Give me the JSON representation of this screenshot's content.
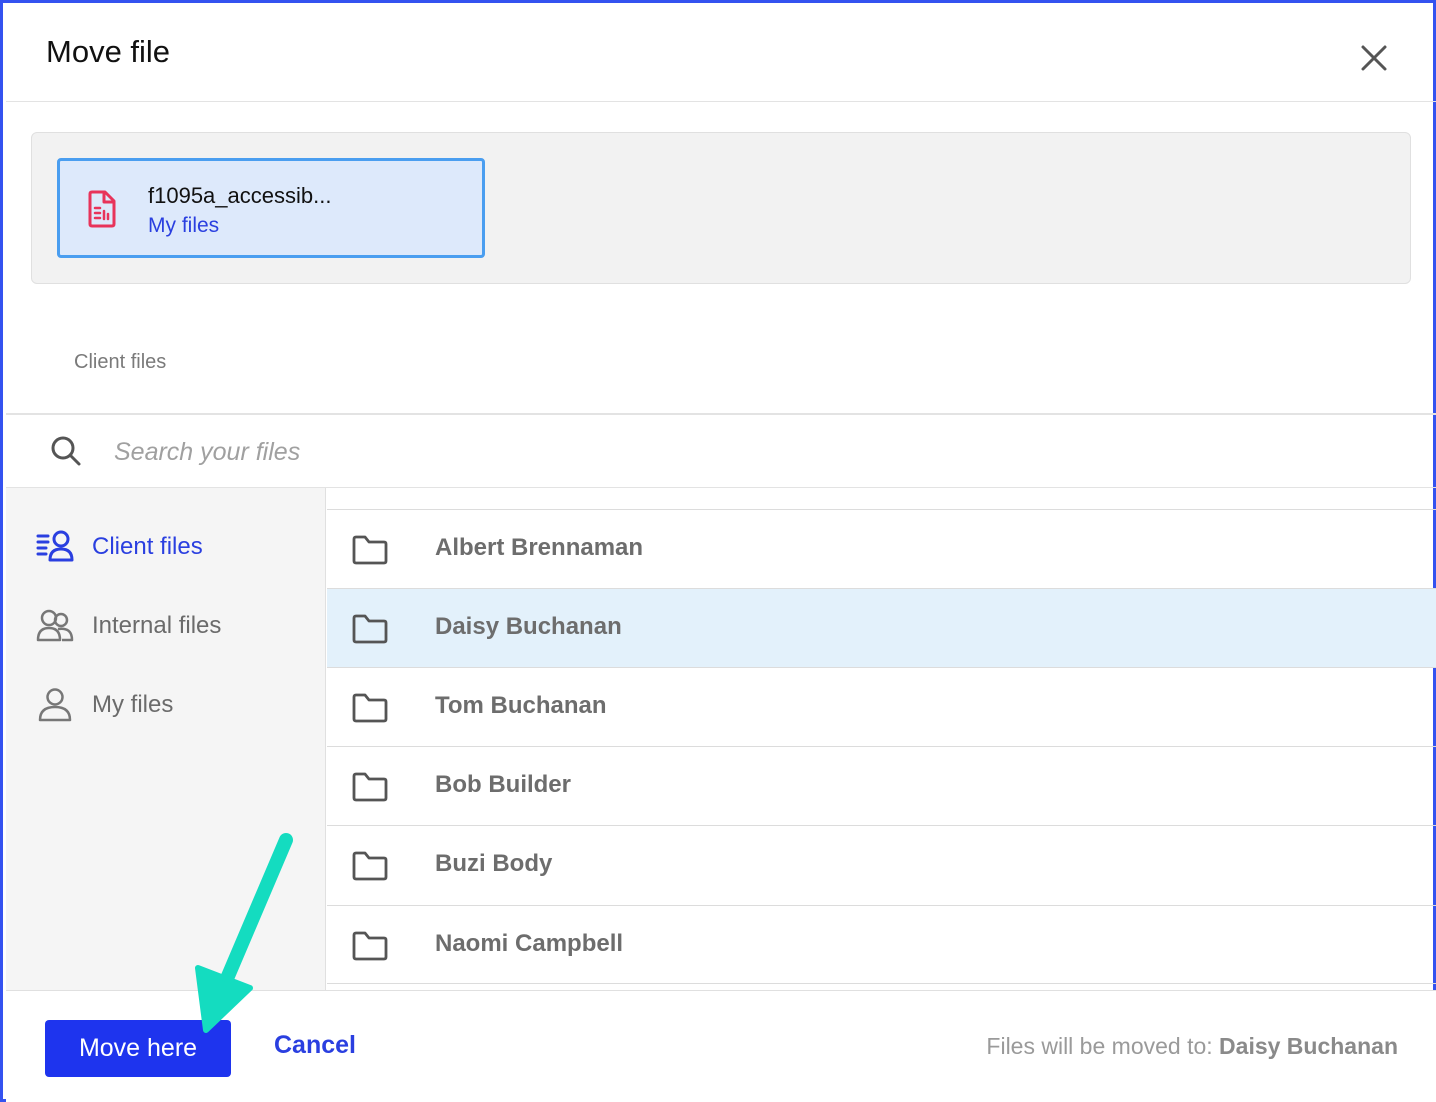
{
  "dialog": {
    "title": "Move file",
    "close_icon": "close-icon"
  },
  "file": {
    "name": "f1095a_accessib...",
    "location": "My files",
    "icon": "document-icon",
    "icon_color": "#e8335a"
  },
  "breadcrumb": "Client files",
  "search": {
    "placeholder": "Search your files",
    "value": ""
  },
  "sidebar": {
    "items": [
      {
        "label": "Client files",
        "icon": "client-files-icon",
        "active": true
      },
      {
        "label": "Internal files",
        "icon": "users-icon",
        "active": false
      },
      {
        "label": "My files",
        "icon": "user-icon",
        "active": false
      }
    ]
  },
  "folders": [
    {
      "name": "Albert Brennaman",
      "selected": false
    },
    {
      "name": "Daisy Buchanan",
      "selected": true
    },
    {
      "name": "Tom Buchanan",
      "selected": false
    },
    {
      "name": "Bob Builder",
      "selected": false
    },
    {
      "name": "Buzi Body",
      "selected": false
    },
    {
      "name": "Naomi Campbell",
      "selected": false
    }
  ],
  "footer": {
    "move_label": "Move here",
    "cancel_label": "Cancel",
    "destination_prefix": "Files will be moved to:",
    "destination_name": "Daisy Buchanan"
  },
  "colors": {
    "accent": "#1e34ee",
    "link": "#2a3fe0",
    "selected_row": "#e3f1fb",
    "annotation_arrow": "#14dcc0"
  }
}
